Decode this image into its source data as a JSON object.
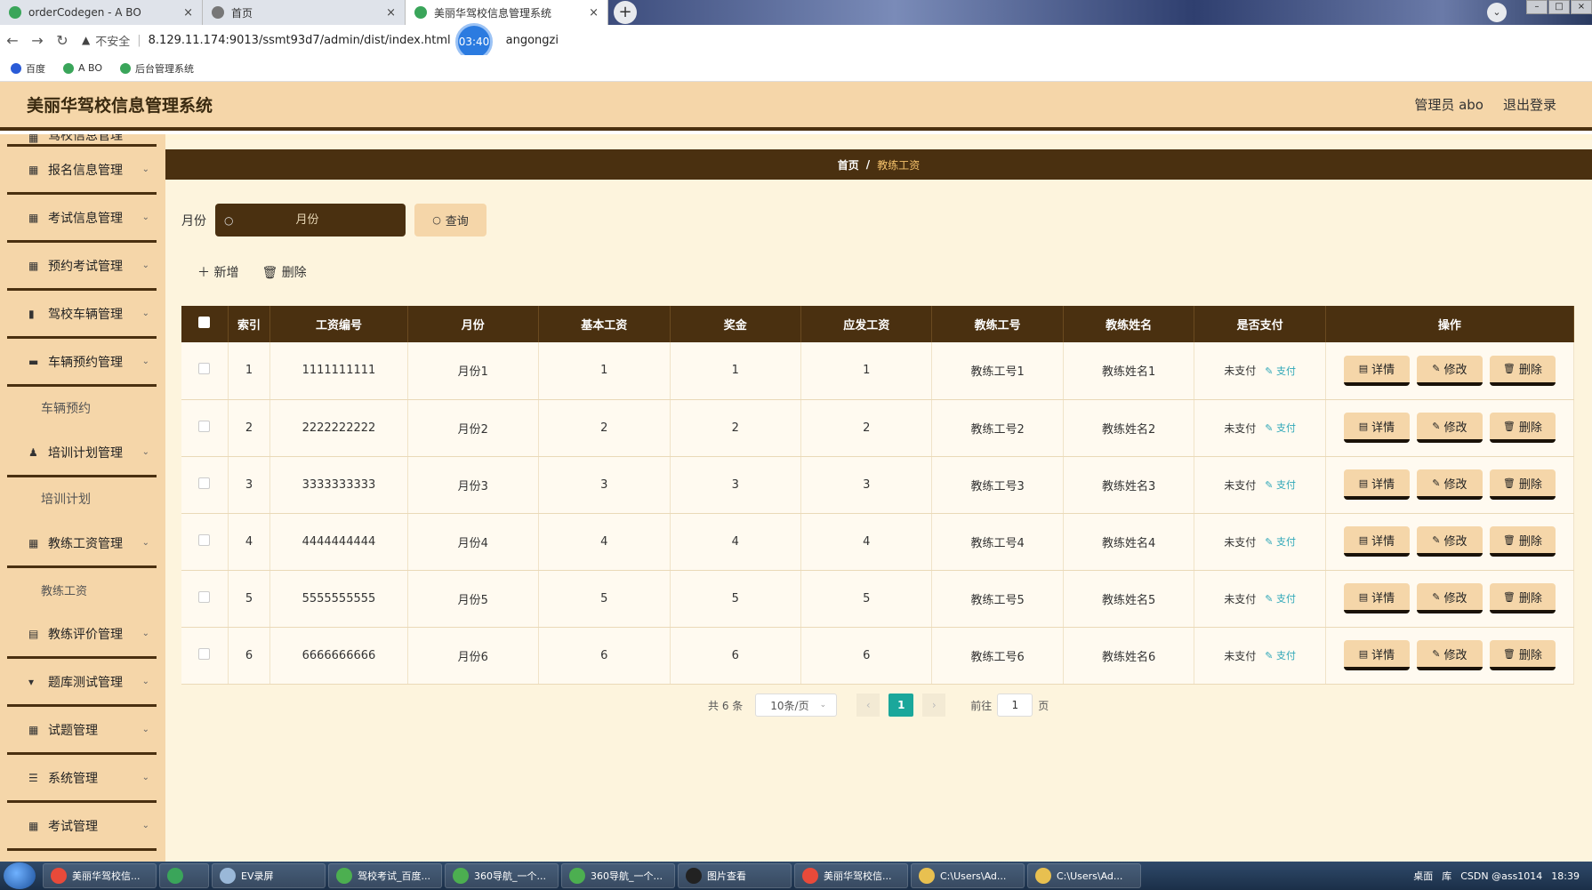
{
  "browser": {
    "tabs": [
      {
        "label": "orderCodegen - A BO",
        "active": false,
        "icon_color": "#3aa55a"
      },
      {
        "label": "首页",
        "active": false,
        "icon_color": "#777777"
      },
      {
        "label": "美丽华驾校信息管理系统",
        "active": true,
        "icon_color": "#3aa55a"
      }
    ],
    "url": {
      "security": "不安全",
      "address_start": "8.129.11.174:9013/ssmt93d7/admin/dist/index.html",
      "address_end": "angongzi"
    },
    "recording_time": "03:40",
    "bookmarks": [
      {
        "label": "百度",
        "icon_color": "#2a5bd7"
      },
      {
        "label": "A BO",
        "icon_color": "#3aa55a"
      },
      {
        "label": "后台管理系统",
        "icon_color": "#3aa55a"
      }
    ]
  },
  "app": {
    "title": "美丽华驾校信息管理系统",
    "user": "管理员 abo",
    "logout": "退出登录"
  },
  "sidebar": {
    "partial_item": "驾校信息管理",
    "items": [
      {
        "label": "报名信息管理",
        "icon": "grid-icon",
        "glyph": "▦"
      },
      {
        "label": "考试信息管理",
        "icon": "grid-icon",
        "glyph": "▦"
      },
      {
        "label": "预约考试管理",
        "icon": "grid-icon",
        "glyph": "▦"
      },
      {
        "label": "驾校车辆管理",
        "icon": "bars-icon",
        "glyph": "▮"
      },
      {
        "label": "车辆预约管理",
        "icon": "car-icon",
        "glyph": "▬"
      },
      {
        "sub": "车辆预约"
      },
      {
        "label": "培训计划管理",
        "icon": "user-icon",
        "glyph": "♟"
      },
      {
        "sub": "培训计划"
      },
      {
        "label": "教练工资管理",
        "icon": "grid-icon",
        "glyph": "▦"
      },
      {
        "sub": "教练工资",
        "small": true
      },
      {
        "label": "教练评价管理",
        "icon": "doc-icon",
        "glyph": "▤"
      },
      {
        "label": "题库测试管理",
        "icon": "flag-icon",
        "glyph": "▾"
      },
      {
        "label": "试题管理",
        "icon": "grid-icon",
        "glyph": "▦"
      },
      {
        "label": "系统管理",
        "icon": "sliders-icon",
        "glyph": "☰"
      },
      {
        "label": "考试管理",
        "icon": "grid-icon",
        "glyph": "▦"
      }
    ]
  },
  "breadcrumb": {
    "home": "首页",
    "current": "教练工资"
  },
  "search": {
    "label": "月份",
    "placeholder": "月份",
    "button": "查询"
  },
  "actions": {
    "add": "新增",
    "delete": "删除"
  },
  "table": {
    "columns": [
      "索引",
      "工资编号",
      "月份",
      "基本工资",
      "奖金",
      "应发工资",
      "教练工号",
      "教练姓名",
      "是否支付",
      "操作"
    ],
    "rows": [
      [
        "1",
        "1111111111",
        "月份1",
        "1",
        "1",
        "1",
        "教练工号1",
        "教练姓名1",
        "未支付"
      ],
      [
        "2",
        "2222222222",
        "月份2",
        "2",
        "2",
        "2",
        "教练工号2",
        "教练姓名2",
        "未支付"
      ],
      [
        "3",
        "3333333333",
        "月份3",
        "3",
        "3",
        "3",
        "教练工号3",
        "教练姓名3",
        "未支付"
      ],
      [
        "4",
        "4444444444",
        "月份4",
        "4",
        "4",
        "4",
        "教练工号4",
        "教练姓名4",
        "未支付"
      ],
      [
        "5",
        "5555555555",
        "月份5",
        "5",
        "5",
        "5",
        "教练工号5",
        "教练姓名5",
        "未支付"
      ],
      [
        "6",
        "6666666666",
        "月份6",
        "6",
        "6",
        "6",
        "教练工号6",
        "教练姓名6",
        "未支付"
      ]
    ],
    "pay_link": "支付",
    "op_buttons": {
      "detail": "详情",
      "edit": "修改",
      "delete": "删除"
    }
  },
  "pagination": {
    "total": "共 6 条",
    "page_size": "10条/页",
    "current_page": "1",
    "goto_label": "前往",
    "goto_value": "1",
    "page_suffix": "页"
  },
  "taskbar": {
    "items": [
      {
        "label": "美丽华驾校信...",
        "icon_color": "#e84a3a"
      },
      {
        "label": "",
        "icon_color": "#3aa55a",
        "narrow": true
      },
      {
        "label": "EV录屏",
        "icon_color": "#9ab8d8"
      },
      {
        "label": "驾校考试_百度...",
        "icon_color": "#4caf50"
      },
      {
        "label": "360导航_一个...",
        "icon_color": "#4caf50"
      },
      {
        "label": "360导航_一个...",
        "icon_color": "#4caf50"
      },
      {
        "label": "图片查看",
        "icon_color": "#222222"
      },
      {
        "label": "美丽华驾校信...",
        "icon_color": "#e84a3a"
      },
      {
        "label": "C:\\Users\\Ad...",
        "icon_color": "#e8c050"
      },
      {
        "label": "C:\\Users\\Ad...",
        "icon_color": "#e8c050"
      }
    ],
    "desktop": "桌面",
    "library": "库",
    "tray_text": "CSDN @ass1014",
    "clock": "18:39"
  },
  "colors": {
    "primary_dark": "#4a3010",
    "header_tan": "#f5d6a9",
    "content_bg": "#fdf4dd",
    "page_active": "#1aa79b",
    "pay_link": "#2fa7b8"
  }
}
